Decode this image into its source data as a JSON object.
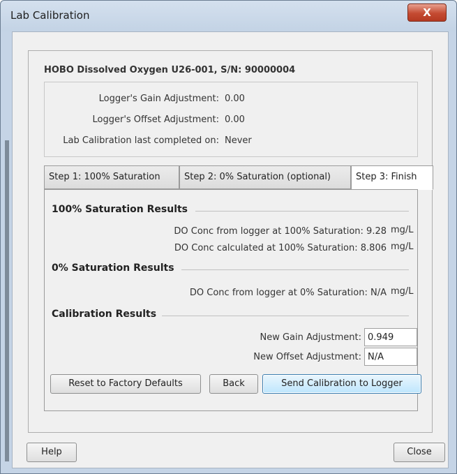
{
  "window": {
    "title": "Lab Calibration",
    "close_glyph": "X"
  },
  "device": {
    "title": "HOBO Dissolved Oxygen U26-001, S/N: 90000004"
  },
  "logger_info": {
    "gain_label": "Logger's Gain Adjustment:",
    "gain_value": "0.00",
    "offset_label": "Logger's Offset Adjustment:",
    "offset_value": "0.00",
    "last_cal_label": "Lab Calibration last completed on:",
    "last_cal_value": "Never"
  },
  "tabs": [
    {
      "label": "Step 1: 100% Saturation"
    },
    {
      "label": "Step 2: 0% Saturation (optional)"
    },
    {
      "label": "Step 3: Finish"
    }
  ],
  "results": {
    "sat100_heading": "100% Saturation Results",
    "sat100_logger_label": "DO Conc from logger at 100% Saturation:",
    "sat100_logger_value": "9.28",
    "sat100_logger_unit": "mg/L",
    "sat100_calc_label": "DO Conc calculated at 100% Saturation:",
    "sat100_calc_value": "8.806",
    "sat100_calc_unit": "mg/L",
    "sat0_heading": "0% Saturation Results",
    "sat0_logger_label": "DO Conc from logger at 0% Saturation:",
    "sat0_logger_value": "N/A",
    "sat0_logger_unit": "mg/L",
    "cal_heading": "Calibration Results",
    "new_gain_label": "New Gain Adjustment:",
    "new_gain_value": "0.949",
    "new_offset_label": "New Offset Adjustment:",
    "new_offset_value": "N/A"
  },
  "buttons": {
    "reset": "Reset to Factory Defaults",
    "back": "Back",
    "send": "Send Calibration to Logger",
    "help": "Help",
    "close": "Close"
  },
  "colors": {
    "title_bar": "#c5d4e6",
    "close_button": "#c44b32",
    "default_button_border": "#3c7fb1"
  }
}
